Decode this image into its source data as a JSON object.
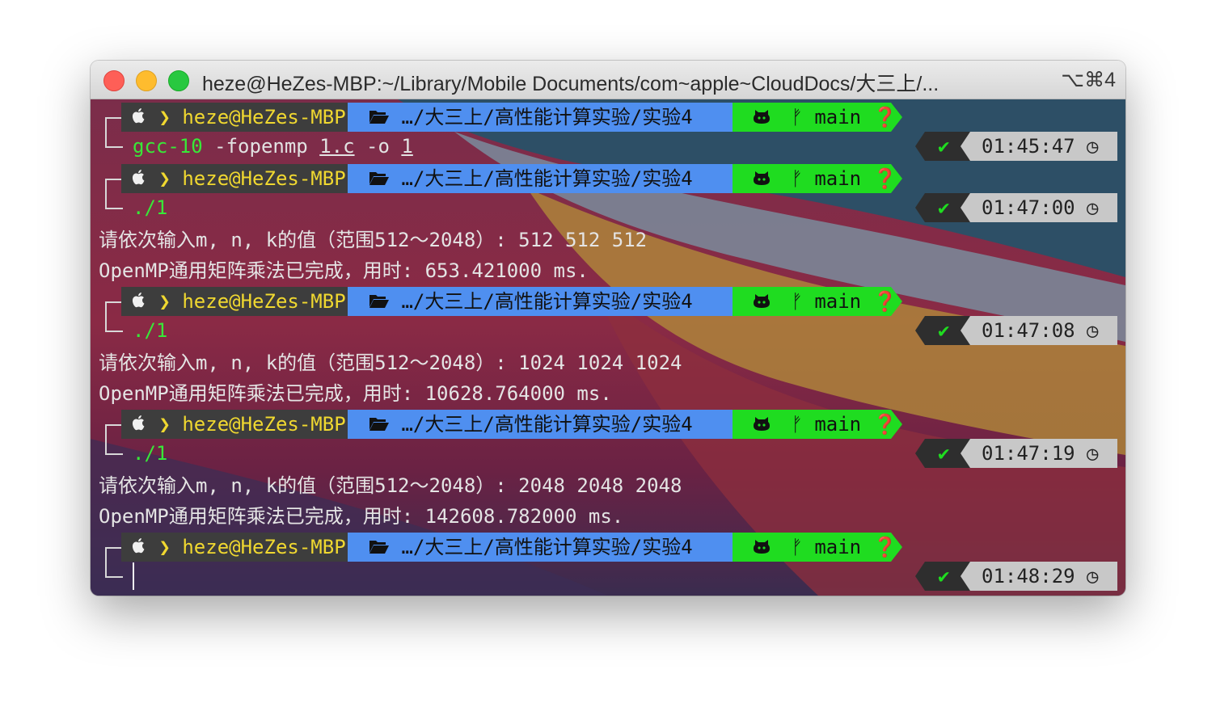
{
  "window": {
    "title": "heze@HeZes-MBP:~/Library/Mobile Documents/com~apple~CloudDocs/大三上/...",
    "shortcut": "⌥⌘4"
  },
  "prompt": {
    "user": "heze@HeZes-MBP",
    "path": "…/大三上/高性能计算实验/实验4",
    "branch": "main",
    "colors": {
      "user_bg": "#3d3d3d",
      "user_fg": "#f0d830",
      "path_bg": "#4f8ff0",
      "git_bg": "#1fdc20"
    }
  },
  "blocks": [
    {
      "command": "gcc-10",
      "args": [
        "-fopenmp",
        "1.c",
        "-o",
        "1"
      ],
      "time": "01:45:47",
      "output": []
    },
    {
      "command": "./1",
      "args": [],
      "time": "01:47:00",
      "output": [
        "请依次输入m, n, k的值（范围512～2048）: 512 512 512",
        "OpenMP通用矩阵乘法已完成，用时: 653.421000 ms."
      ]
    },
    {
      "command": "./1",
      "args": [],
      "time": "01:47:08",
      "output": [
        "请依次输入m, n, k的值（范围512～2048）: 1024 1024 1024",
        "OpenMP通用矩阵乘法已完成，用时: 10628.764000 ms."
      ]
    },
    {
      "command": "./1",
      "args": [],
      "time": "01:47:19",
      "output": [
        "请依次输入m, n, k的值（范围512～2048）: 2048 2048 2048",
        "OpenMP通用矩阵乘法已完成，用时: 142608.782000 ms."
      ]
    },
    {
      "command": "",
      "args": [],
      "time": "01:48:29",
      "output": []
    }
  ]
}
